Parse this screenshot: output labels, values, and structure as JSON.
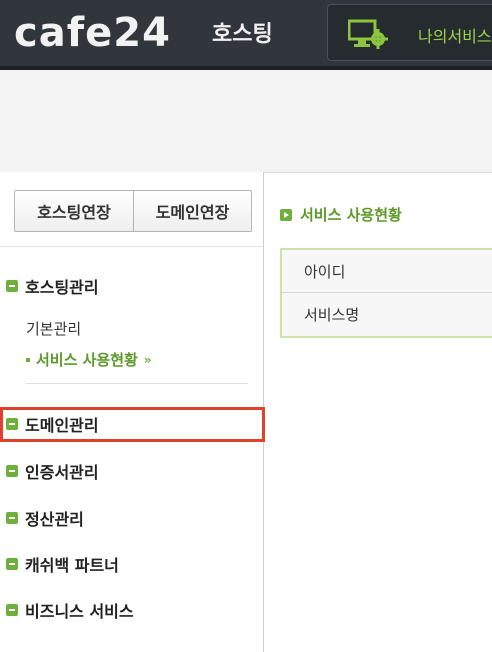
{
  "header": {
    "logo_text": "cafe24",
    "logo_sub": "호스팅",
    "my_service_label": "나의서비스",
    "my_service_icon": "monitor-gear-icon"
  },
  "sidebar": {
    "buttons": [
      "호스팅연장",
      "도메인연장"
    ],
    "menus": [
      {
        "label": "호스팅관리"
      },
      {
        "label": "도메인관리"
      },
      {
        "label": "인증서관리"
      },
      {
        "label": "정산관리"
      },
      {
        "label": "캐쉬백 파트너"
      },
      {
        "label": "비즈니스 서비스"
      }
    ],
    "submenus": [
      {
        "label": "기본관리"
      },
      {
        "label": "서비스 사용현황",
        "active": true
      }
    ],
    "active_arrow": "»"
  },
  "main": {
    "title": "서비스 사용현황",
    "rows": [
      "아이디",
      "서비스명"
    ]
  },
  "colors": {
    "header_bg": "#30363b",
    "accent_green": "#6fb03d",
    "highlight_red": "#e2402b"
  }
}
